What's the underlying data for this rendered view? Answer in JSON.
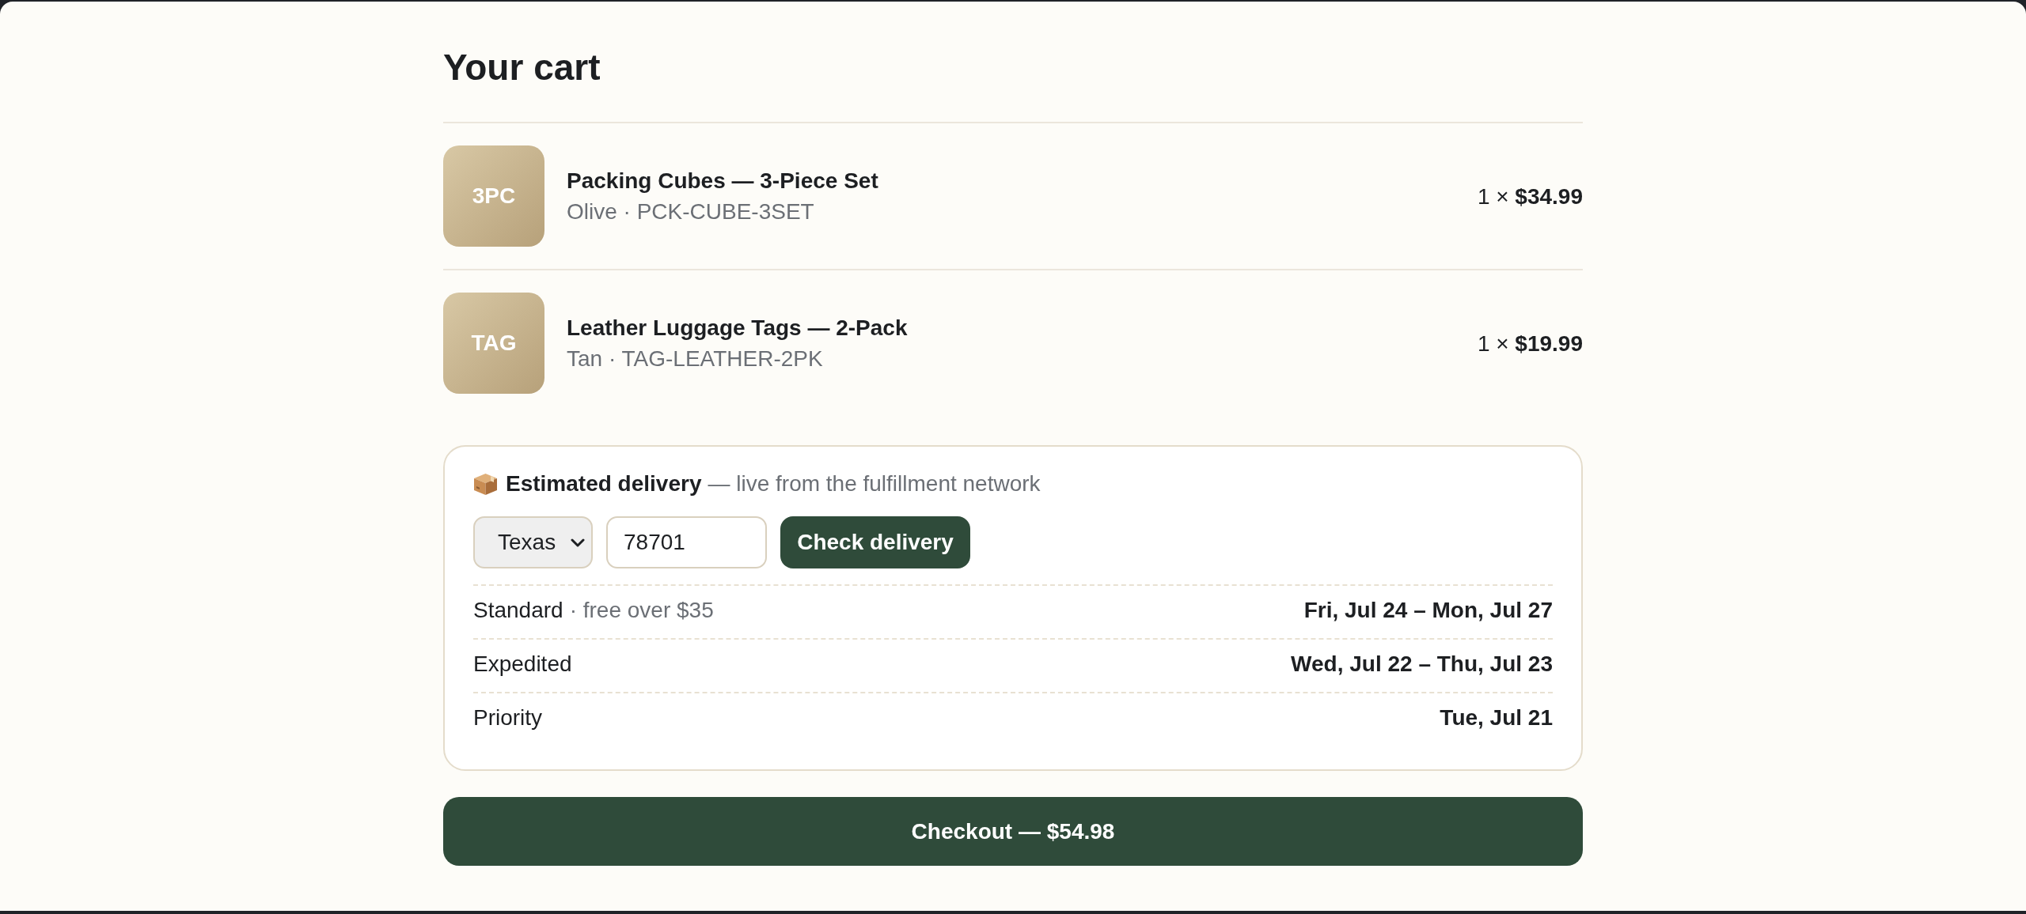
{
  "title": "Your cart",
  "items": [
    {
      "thumb": "3PC",
      "name": "Packing Cubes — 3-Piece Set",
      "variant": "Olive · PCK-CUBE-3SET",
      "quantity_price": "1 × **$34.99**"
    },
    {
      "thumb": "TAG",
      "name": "Leather Luggage Tags — 2-Pack",
      "variant": "Tan · TAG-LEATHER-2PK",
      "quantity_price": "1 × **$19.99**"
    }
  ],
  "delivery": {
    "title": "Estimated delivery",
    "subtitle": "— live from the fulfillment network",
    "state_select": {
      "value": "Texas"
    },
    "zip_field": {
      "value": "78701"
    },
    "check_button": "Check delivery",
    "options": [
      {
        "name": "Standard",
        "note": "· free over $35",
        "dates": "Fri, Jul 24 – Mon, Jul 27"
      },
      {
        "name": "Expedited",
        "dates": "Wed, Jul 22 – Thu, Jul 23"
      },
      {
        "name": "Priority",
        "dates": "Tue, Jul 21"
      }
    ]
  },
  "checkout_button": "Checkout — $54.98"
}
